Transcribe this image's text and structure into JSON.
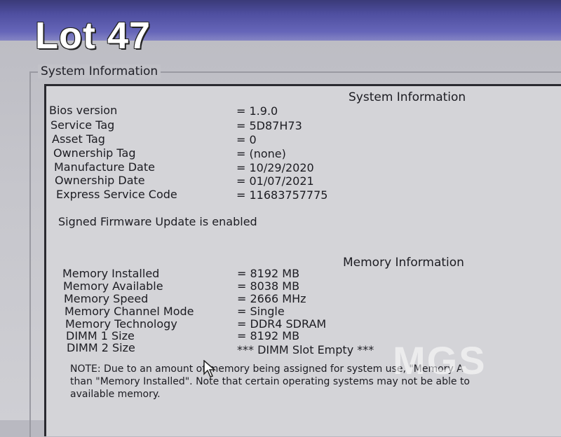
{
  "overlay": {
    "lot": "Lot 47",
    "watermark": "MGS"
  },
  "group_title": "System Information",
  "system": {
    "header": "System Information",
    "rows": [
      {
        "label": "Bios version",
        "value": "= 1.9.0"
      },
      {
        "label": "Service Tag",
        "value": "= 5D87H73"
      },
      {
        "label": "Asset Tag",
        "value": "= 0"
      },
      {
        "label": "Ownership Tag",
        "value": "= (none)"
      },
      {
        "label": "Manufacture Date",
        "value": "= 10/29/2020"
      },
      {
        "label": "Ownership Date",
        "value": "= 01/07/2021"
      },
      {
        "label": "Express Service Code",
        "value": "= 11683757775"
      }
    ],
    "firmware": "Signed Firmware Update is enabled"
  },
  "memory": {
    "header": "Memory Information",
    "rows": [
      {
        "label": "Memory Installed",
        "value": "= 8192 MB"
      },
      {
        "label": "Memory Available",
        "value": "= 8038 MB"
      },
      {
        "label": "Memory Speed",
        "value": "= 2666 MHz"
      },
      {
        "label": "Memory Channel Mode",
        "value": "= Single"
      },
      {
        "label": "Memory Technology",
        "value": "= DDR4 SDRAM"
      },
      {
        "label": "DIMM 1 Size",
        "value": "= 8192 MB"
      },
      {
        "label": "DIMM 2 Size",
        "value": "*** DIMM Slot Empty ***"
      }
    ]
  },
  "note": {
    "line1": "NOTE: Due to an amount of memory being assigned for system use, \"Memory A",
    "line2": "than \"Memory Installed\". Note that certain operating systems may not be able to",
    "line3": "available memory."
  }
}
